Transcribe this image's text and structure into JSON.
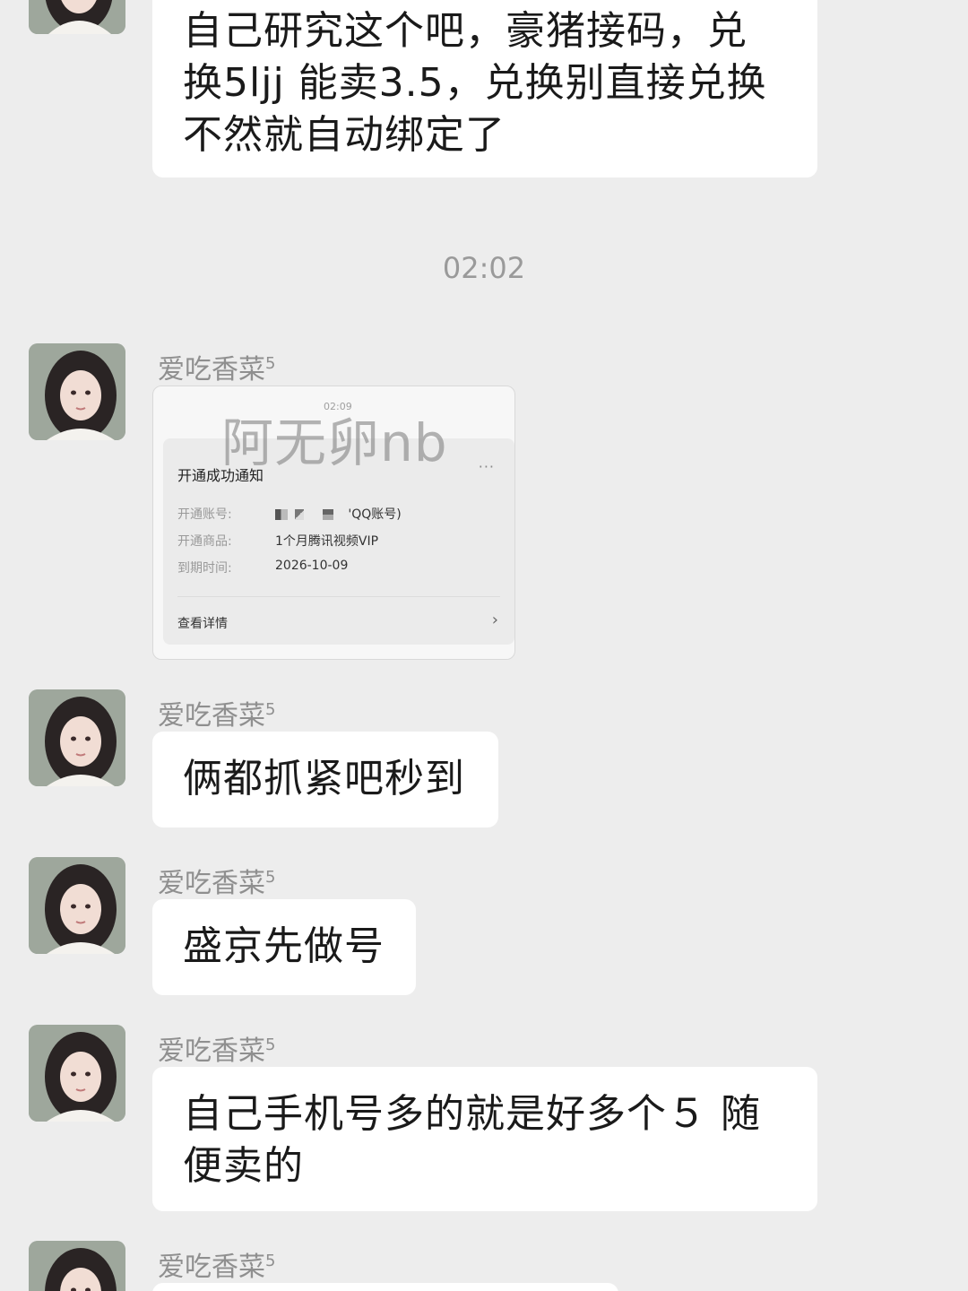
{
  "messages": {
    "m0_text": "自己研究这个吧，豪猪接码，兑换5ljj 能卖3.5，兑换别直接兑换不然就自动绑定了",
    "time_separator": "02:02",
    "sender_name": "爱吃香菜",
    "sender_badge": "5",
    "m2_text": "俩都抓紧吧秒到",
    "m3_text": "盛京先做号",
    "m4_text": "自己手机号多的就是好多个５ 随便卖的"
  },
  "image_card": {
    "small_time": "02:09",
    "watermark": "阿无卵nb",
    "title": "开通成功通知",
    "more_icon": "more-dots-icon",
    "account_label": "开通账号:",
    "account_value_suffix": "'QQ账号)",
    "product_label": "开通商品:",
    "product_value": "1个月腾讯视频VIP",
    "expire_label": "到期时间:",
    "expire_value": "2026-10-09",
    "details_label": "查看详情",
    "chevron_icon": "chevron-right-icon"
  },
  "colors": {
    "background": "#ededed",
    "bubble": "#ffffff",
    "meta_text": "#8f8f8f"
  }
}
